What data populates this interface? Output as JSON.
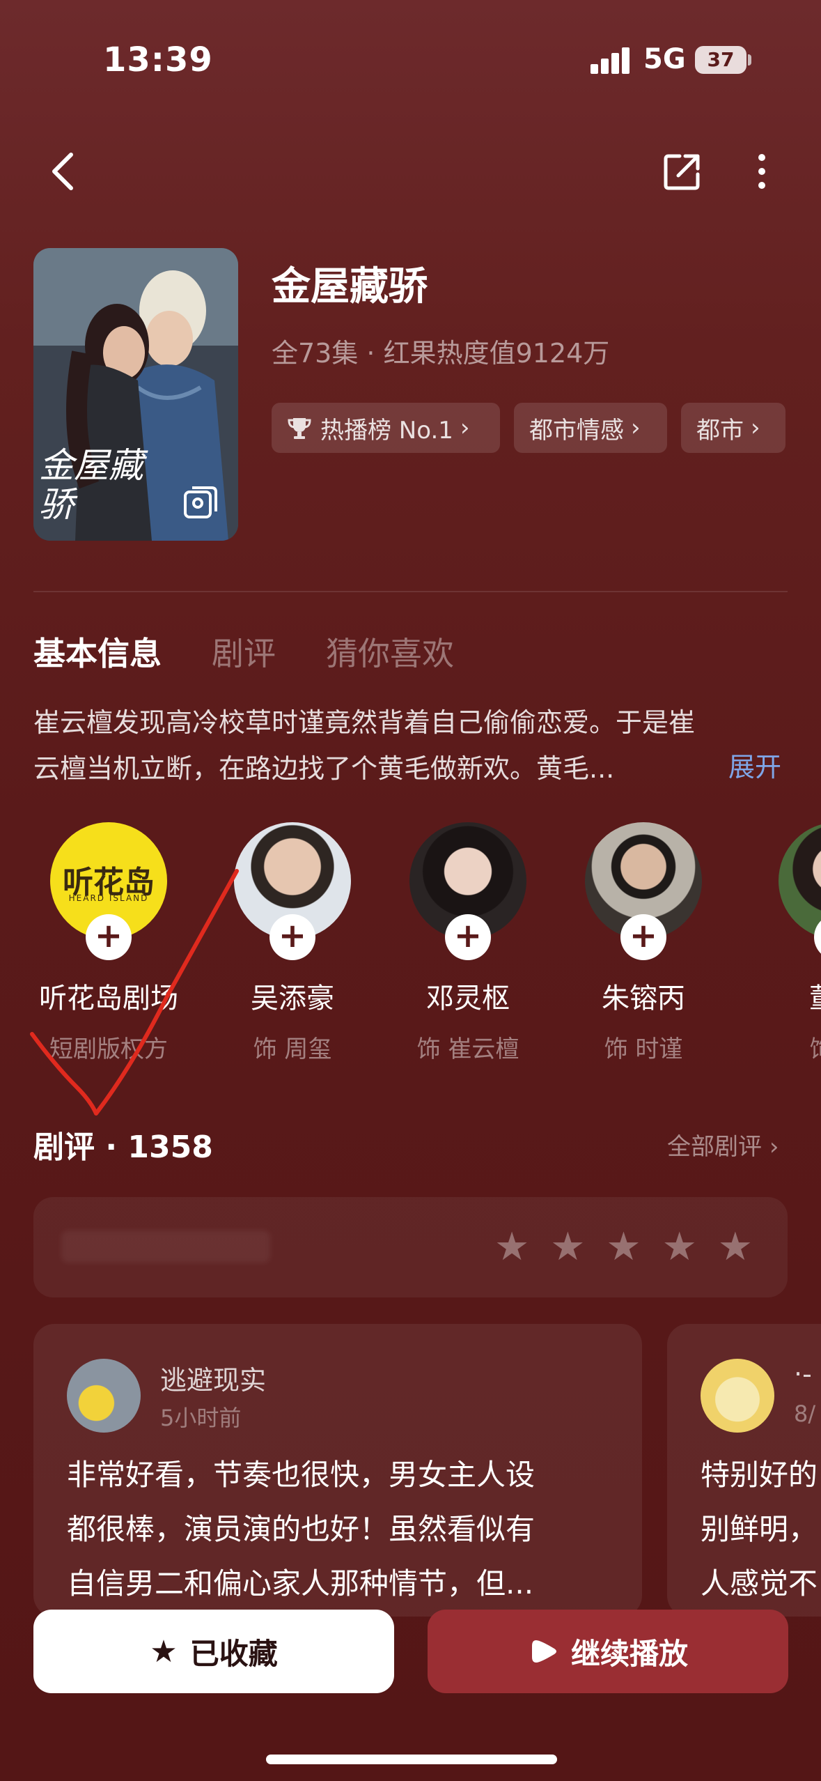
{
  "status": {
    "time": "13:39",
    "network": "5G",
    "battery": "37"
  },
  "show": {
    "title": "金屋藏骄",
    "meta": "全73集 · 红果热度值9124万",
    "tags": [
      "热播榜 No.1",
      "都市情感",
      "都市"
    ],
    "poster_text": "金屋藏骄"
  },
  "tabs": [
    {
      "label": "基本信息",
      "active": true
    },
    {
      "label": "剧评",
      "active": false
    },
    {
      "label": "猜你喜欢",
      "active": false
    }
  ],
  "description": {
    "line1": "崔云檀发现高冷校草时谨竟然背着自己偷偷恋爱。于是崔",
    "line2": "云檀当机立断，在路边找了个黄毛做新欢。黄毛...",
    "expand_label": "展开"
  },
  "cast": [
    {
      "name": "听花岛剧场",
      "role": "短剧版权方",
      "logo_text": "听花岛",
      "logo_sub": "HEARD ISLAND"
    },
    {
      "name": "吴添豪",
      "role": "饰 周玺"
    },
    {
      "name": "邓灵枢",
      "role": "饰 崔云檀"
    },
    {
      "name": "朱镕丙",
      "role": "饰 时谨"
    },
    {
      "name": "董雨",
      "role": "饰 何"
    }
  ],
  "reviews": {
    "title": "剧评 · 1358",
    "all_label": "全部剧评",
    "items": [
      {
        "user": "逃避现实",
        "time": "5小时前",
        "line1": "非常好看，节奏也很快，男女主人设",
        "line2": "都很棒，演员演的也好！虽然看似有",
        "line3": "自信男二和偏心家人那种情节，但..."
      },
      {
        "user": "·-",
        "time": "8/",
        "line1": "特别好的",
        "line2": "别鲜明，",
        "line3": "人感觉不"
      }
    ]
  },
  "actions": {
    "favorite_label": "已收藏",
    "play_label": "继续播放"
  },
  "colors": {
    "accent": "#9a2e33",
    "link": "#7fa6e8",
    "bg": "#5a1a1a"
  }
}
